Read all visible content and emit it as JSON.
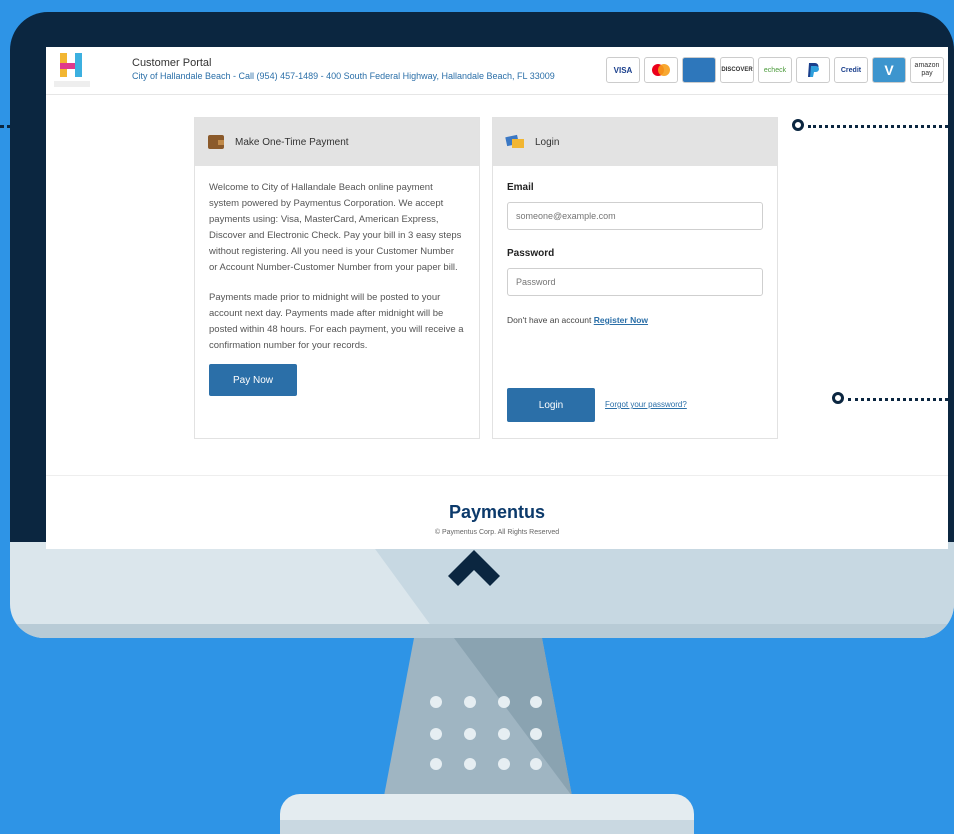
{
  "header": {
    "portal_title": "Customer Portal",
    "portal_subtitle": "City of Hallandale Beach - Call (954) 457-1489 - 400 South Federal Highway, Hallandale Beach, FL 33009",
    "cards": [
      "VISA",
      "MC",
      "AMEX",
      "DISCOVER",
      "echeck",
      "PayPal",
      "Credit",
      "V",
      "amazon pay"
    ]
  },
  "payment_panel": {
    "title": "Make One-Time Payment",
    "paragraph1": "Welcome to City of Hallandale Beach online payment system powered by Paymentus Corporation. We accept payments using: Visa, MasterCard, American Express, Discover and Electronic Check. Pay your bill in 3 easy steps without registering. All you need is your Customer Number or Account Number-Customer Number from your paper bill.",
    "paragraph2": "Payments made prior to midnight will be posted to your account next day. Payments made after midnight will be posted within 48 hours. For each payment, you will receive a confirmation number for your records.",
    "pay_now_label": "Pay Now"
  },
  "login_panel": {
    "title": "Login",
    "email_label": "Email",
    "email_placeholder": "someone@example.com",
    "password_label": "Password",
    "password_placeholder": "Password",
    "no_account_text": "Don't have an account",
    "register_label": "Register Now",
    "login_label": "Login",
    "forgot_label": "Forgot your password?"
  },
  "footer": {
    "brand": "Paymentus",
    "copyright": "© Paymentus Corp. All Rights Reserved"
  },
  "colors": {
    "background": "#2e94e6",
    "bezel": "#0b2640",
    "accent": "#2b6fa8"
  }
}
